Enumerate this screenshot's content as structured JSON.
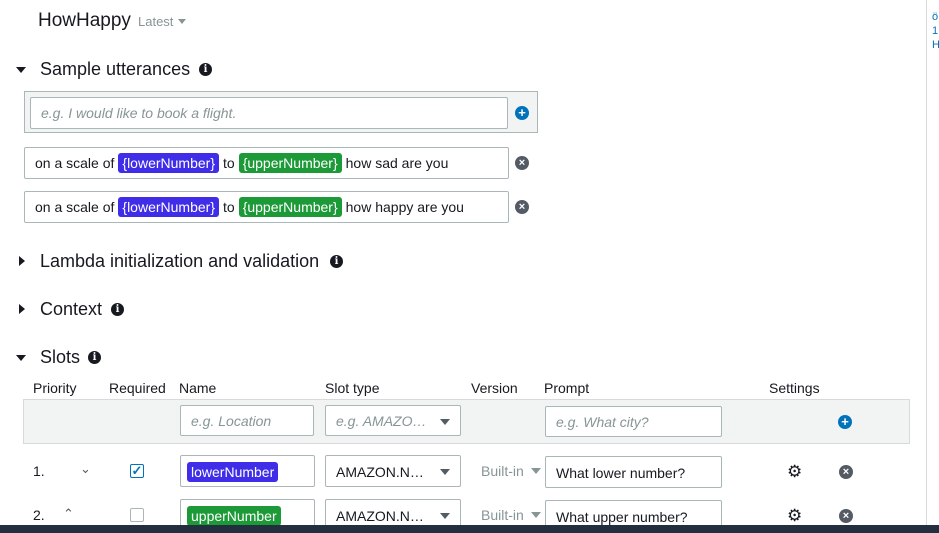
{
  "header": {
    "bot_name": "HowHappy",
    "version": "Latest"
  },
  "sample_utterances": {
    "title": "Sample utterances",
    "input_placeholder": "e.g. I would like to book a flight.",
    "items": [
      {
        "prefix": "on a scale of",
        "slot1": "{lowerNumber}",
        "middle": "to",
        "slot2": "{upperNumber}",
        "suffix": "how sad are you"
      },
      {
        "prefix": "on a scale of",
        "slot1": "{lowerNumber}",
        "middle": "to",
        "slot2": "{upperNumber}",
        "suffix": "how happy are you"
      }
    ]
  },
  "sections": {
    "lambda": "Lambda initialization and validation",
    "context": "Context",
    "slots": "Slots"
  },
  "slots_table": {
    "columns": {
      "priority": "Priority",
      "required": "Required",
      "name": "Name",
      "slot_type": "Slot type",
      "version": "Version",
      "prompt": "Prompt",
      "settings": "Settings"
    },
    "new_row": {
      "name_placeholder": "e.g. Location",
      "type_placeholder": "e.g. AMAZO…",
      "prompt_placeholder": "e.g. What city?"
    },
    "rows": [
      {
        "priority": "1.",
        "required": true,
        "name": "lowerNumber",
        "slot_type": "AMAZON.N…",
        "version": "Built-in",
        "prompt": "What lower number?"
      },
      {
        "priority": "2.",
        "required": false,
        "name": "upperNumber",
        "slot_type": "AMAZON.N…",
        "version": "Built-in",
        "prompt": "What upper number?"
      }
    ]
  },
  "right_panel_text": "ö 1 H",
  "colors": {
    "slot_blue": "#3f2de8",
    "slot_green": "#1d9a38",
    "accent_blue": "#0073bb"
  }
}
